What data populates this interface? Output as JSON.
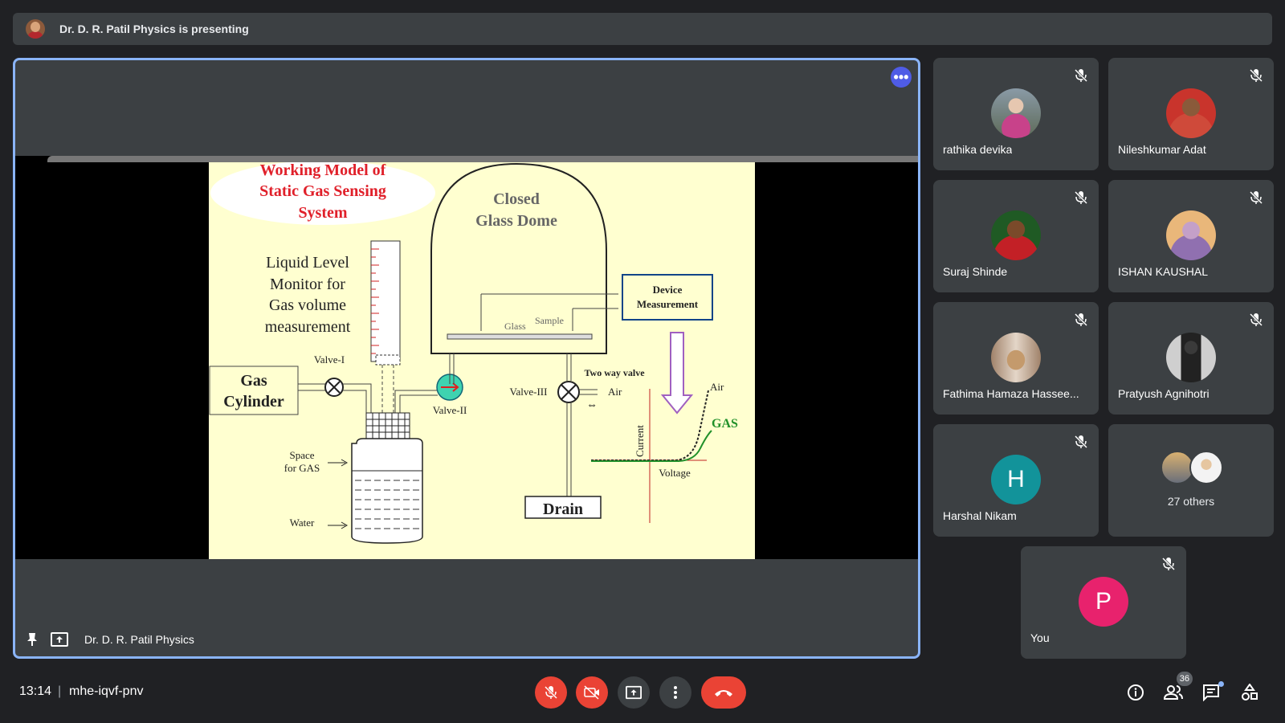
{
  "banner": {
    "text": "Dr. D. R. Patil Physics is presenting"
  },
  "main": {
    "presenter_name": "Dr. D. R. Patil Physics",
    "more_label": "•••",
    "slide": {
      "title_lines": [
        "Working Model of",
        "Static Gas Sensing",
        "System"
      ],
      "dome_lines": [
        "Closed",
        "Glass Dome"
      ],
      "liquid_lines": [
        "Liquid Level",
        "Monitor for",
        "Gas volume",
        "measurement"
      ],
      "valve1": "Valve-I",
      "valve2": "Valve-II",
      "valve3": "Valve-III",
      "gas_cylinder_lines": [
        "Gas",
        "Cylinder"
      ],
      "space_lines": [
        "Space",
        "for GAS"
      ],
      "water": "Water",
      "glass": "Glass",
      "sample": "Sample",
      "device_lines": [
        "Device",
        "Measurement"
      ],
      "two_way": "Two way valve",
      "air1": "Air",
      "air2": "Air",
      "gas": "GAS",
      "current": "Current",
      "voltage": "Voltage",
      "drain": "Drain"
    }
  },
  "participants": [
    {
      "name": "rathika devika",
      "avatar": "photo"
    },
    {
      "name": "Nileshkumar Adat",
      "avatar": "photo"
    },
    {
      "name": "Suraj Shinde",
      "avatar": "photo"
    },
    {
      "name": "ISHAN KAUSHAL",
      "avatar": "photo"
    },
    {
      "name": "Fathima Hamaza Hassee...",
      "avatar": "photo"
    },
    {
      "name": "Pratyush Agnihotri",
      "avatar": "photo"
    },
    {
      "name": "Harshal Nikam",
      "avatar_letter": "H",
      "avatar_color": "#12939a"
    }
  ],
  "others": {
    "label": "27 others"
  },
  "self": {
    "name": "You",
    "avatar_letter": "P",
    "avatar_color": "#e8226d"
  },
  "bottombar": {
    "time": "13:14",
    "separator": "|",
    "meeting_code": "mhe-iqvf-pnv",
    "people_count": "36",
    "icons": [
      "mic-off-icon",
      "camera-off-icon",
      "present-icon",
      "more-vert-icon",
      "hang-up-icon",
      "info-icon",
      "people-icon",
      "chat-icon",
      "activities-icon"
    ]
  },
  "colors": {
    "accent": "#8ab4f8",
    "danger": "#ea4335",
    "tile": "#3c4043",
    "background": "#202124"
  }
}
